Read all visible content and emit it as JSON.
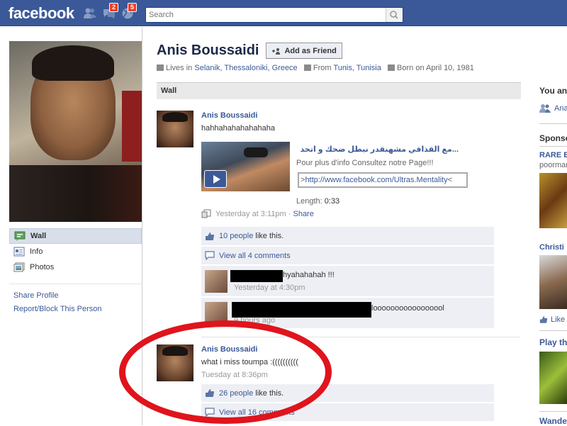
{
  "topbar": {
    "logo": "facebook",
    "friend_requests_count": "",
    "messages_count": "2",
    "notifications_count": "5",
    "search_placeholder": "Search"
  },
  "left": {
    "nav": [
      {
        "label": "Wall",
        "icon": "wall-icon",
        "active": true
      },
      {
        "label": "Info",
        "icon": "info-icon"
      },
      {
        "label": "Photos",
        "icon": "photos-icon"
      }
    ],
    "links": [
      "Share Profile",
      "Report/Block This Person"
    ]
  },
  "profile": {
    "name": "Anis Boussaidi",
    "add_friend_label": "Add as Friend",
    "lives_prefix": "Lives in",
    "lives_city": "Selanik, Thessaloniki, Greece",
    "from_prefix": "From",
    "from_city": "Tunis, Tunisia",
    "born": "Born on April 10, 1981"
  },
  "wall": {
    "header": "Wall",
    "story1": {
      "author": "Anis Boussaidi",
      "text": "hahhahahahahahaha",
      "attachment_title": "...مع القذافي مشهنقدر نبطل ضحك و اتحد",
      "attachment_desc": "Pour plus d'info Consultez notre Page!!!",
      "attachment_link_prefix": ">",
      "attachment_link": "http://www.facebook.com/Ultras.Mentality",
      "attachment_link_suffix": "<",
      "length_label": "Length:",
      "length_value": "0:33",
      "time": "Yesterday at 3:11pm",
      "sep": "·",
      "share": "Share",
      "likes_link": "10 people",
      "likes_suffix": "like this.",
      "view_comments": "View all 4 comments",
      "comments": [
        {
          "text": "hyahahahah !!!",
          "time": "Yesterday at 4:30pm"
        },
        {
          "text": "looooooooooooooool",
          "time": "9 hours ago"
        }
      ]
    },
    "story2": {
      "author": "Anis Boussaidi",
      "text": "what i miss toumpa :((((((((((",
      "time": "Tuesday at 8:36pm",
      "likes_link": "26 people",
      "likes_suffix": "like this.",
      "view_comments": "View all 16 comments"
    }
  },
  "right": {
    "you_and": "You an",
    "mutual": "Ana",
    "sponsored": "Sponso",
    "ad1_title": "RARE E",
    "ad1_sub": "poormar",
    "ad2_title": "Christi",
    "like_label": "Like",
    "ad3_title": "Play th",
    "ad4_title": "Wande"
  }
}
